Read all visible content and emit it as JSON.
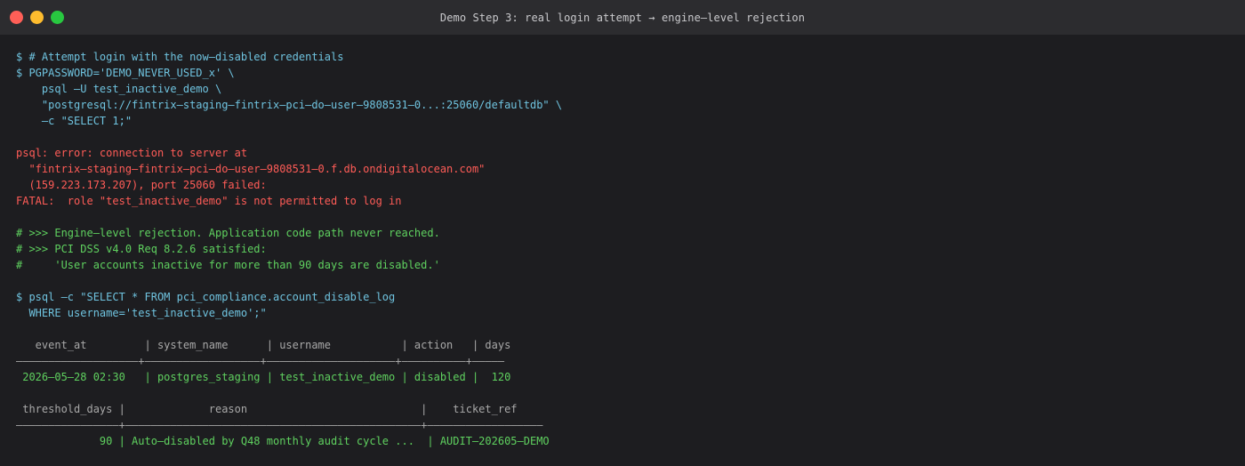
{
  "window": {
    "title": "Demo Step 3: real login attempt → engine–level rejection"
  },
  "terminal": {
    "lines": [
      {
        "text": "$ # Attempt login with the now–disabled credentials",
        "kind": "cmd"
      },
      {
        "text": "$ PGPASSWORD='DEMO_NEVER_USED_x' \\",
        "kind": "cmd"
      },
      {
        "text": "    psql –U test_inactive_demo \\",
        "kind": "cmd"
      },
      {
        "text": "    \"postgresql://fintrix–staging–fintrix–pci–do–user–9808531–0...:25060/defaultdb\" \\",
        "kind": "cmd"
      },
      {
        "text": "    –c \"SELECT 1;\"",
        "kind": "cmd"
      },
      {
        "text": "",
        "kind": "blank"
      },
      {
        "text": "psql: error: connection to server at",
        "kind": "err"
      },
      {
        "text": "  \"fintrix–staging–fintrix–pci–do–user–9808531–0.f.db.ondigitalocean.com\"",
        "kind": "err"
      },
      {
        "text": "  (159.223.173.207), port 25060 failed:",
        "kind": "err"
      },
      {
        "text": "FATAL:  role \"test_inactive_demo\" is not permitted to log in",
        "kind": "err"
      },
      {
        "text": "",
        "kind": "blank"
      },
      {
        "text": "# >>> Engine–level rejection. Application code path never reached.",
        "kind": "cmt"
      },
      {
        "text": "# >>> PCI DSS v4.0 Req 8.2.6 satisfied:",
        "kind": "cmt"
      },
      {
        "text": "#     'User accounts inactive for more than 90 days are disabled.'",
        "kind": "cmt"
      },
      {
        "text": "",
        "kind": "blank"
      },
      {
        "text": "$ psql –c \"SELECT * FROM pci_compliance.account_disable_log",
        "kind": "cmd"
      },
      {
        "text": "  WHERE username='test_inactive_demo';\"",
        "kind": "cmd"
      },
      {
        "text": "",
        "kind": "blank"
      },
      {
        "text": "   event_at         | system_name      | username           | action   | days",
        "kind": "thead"
      },
      {
        "text": "–––––––––––––––––––+––––––––––––––––––+––––––––––––––––––––+––––––––––+–––––",
        "kind": "tsep"
      },
      {
        "text": " 2026–05–28 02:30   | postgres_staging | test_inactive_demo | disabled |  120",
        "kind": "tval"
      },
      {
        "text": "",
        "kind": "blank"
      },
      {
        "text": " threshold_days |             reason                           |    ticket_ref",
        "kind": "thead"
      },
      {
        "text": "––––––––––––––––+––––––––––––––––––––––––––––––––––––––––––––––+––––––––––––––––––",
        "kind": "tsep"
      },
      {
        "text": "             90 | Auto–disabled by Q48 monthly audit cycle ...  | AUDIT–202605–DEMO",
        "kind": "tval"
      }
    ]
  }
}
